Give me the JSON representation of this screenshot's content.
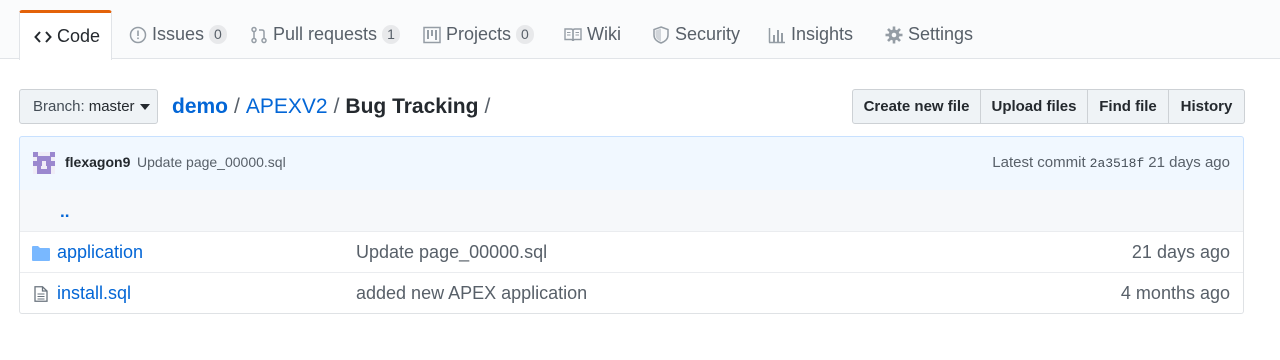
{
  "repo_nav": {
    "tabs": [
      {
        "label": "Code",
        "icon": "code-icon",
        "counter": null
      },
      {
        "label": "Issues",
        "icon": "issue-icon",
        "counter": "0"
      },
      {
        "label": "Pull requests",
        "icon": "pull-request-icon",
        "counter": "1"
      },
      {
        "label": "Projects",
        "icon": "project-icon",
        "counter": "0"
      },
      {
        "label": "Wiki",
        "icon": "book-icon",
        "counter": null
      },
      {
        "label": "Security",
        "icon": "shield-icon",
        "counter": null
      },
      {
        "label": "Insights",
        "icon": "graph-icon",
        "counter": null
      },
      {
        "label": "Settings",
        "icon": "gear-icon",
        "counter": null
      }
    ],
    "selected_tab": "Code",
    "accent_color": "#e36209"
  },
  "file_nav": {
    "branch_label": "Branch:",
    "branch_value": "master",
    "breadcrumb": {
      "root": "demo",
      "path": [
        "APEXV2"
      ],
      "current": "Bug Tracking",
      "separator": "/"
    },
    "buttons": {
      "create_new_file": "Create new file",
      "upload_files": "Upload files",
      "find_file": "Find file",
      "history": "History"
    }
  },
  "latest_commit": {
    "author": "flexagon9",
    "message": "Update page_00000.sql",
    "prefix": "Latest commit",
    "sha": "2a3518f",
    "age": "21 days ago"
  },
  "files": {
    "parent_link": "..",
    "rows": [
      {
        "type": "directory",
        "icon": "folder-icon",
        "name": "application",
        "message": "Update page_00000.sql",
        "age": "21 days ago"
      },
      {
        "type": "file",
        "icon": "file-icon",
        "name": "install.sql",
        "message": "added new APEX application",
        "age": "4 months ago"
      }
    ]
  },
  "colors": {
    "link": "#0366d6",
    "muted": "#586069",
    "commit_bg": "#f1f8ff",
    "folder": "#79b8ff"
  }
}
